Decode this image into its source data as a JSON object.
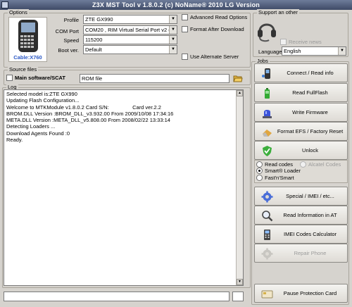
{
  "window": {
    "title": "Z3X MST Tool v 1.8.0.2 (c) NoName® 2010 LG Version"
  },
  "options": {
    "group_label": "Options",
    "phone_label": "Cable:X760",
    "profile": {
      "label": "Profile",
      "value": "ZTE GX990"
    },
    "com_port": {
      "label": "COM Port",
      "value": "COM20 , RIM Virtual Serial Port v2 (CO"
    },
    "speed": {
      "label": "Speed",
      "value": "115200"
    },
    "boot_ver": {
      "label": "Boot ver.",
      "value": "Default"
    },
    "advanced_read": {
      "label": "Advanced Read Options",
      "checked": false
    },
    "format_after": {
      "label": "Format After Download",
      "checked": false
    },
    "alt_server": {
      "label": "Use Alternate Server",
      "checked": false
    }
  },
  "support": {
    "group_label": "Support an other",
    "receive_news": {
      "label": "Receive news",
      "checked": false
    },
    "language": {
      "label": "Language",
      "value": "English"
    }
  },
  "source": {
    "group_label": "Source files",
    "main_label": "Main software/SCAT",
    "rom_value": "ROM file"
  },
  "log": {
    "group_label": "Log",
    "lines": [
      "Selected model is:ZTE GX990",
      "Updating Flash Configuration...",
      "Welcome to MTKModule v1.8.0.2 Card S/N:                Card ver.2.2",
      "BROM.DLL Version :BROM_DLL_v3.932.00 From 2009/10/08 17:34:16",
      "META.DLL Version :META_DLL_v5.808.00 From 2008/02/22 13:33:14",
      "Detecting Loaders ...",
      "Download Agents Found :0",
      "Ready."
    ]
  },
  "jobs": {
    "group_label": "Jobs",
    "connect": "Connect / Read info",
    "read_flash": "Read FullFlash",
    "write_fw": "Write Firmware",
    "format": "Format EFS / Factory Reset",
    "unlock": "Unlock",
    "read_codes": "Read codes",
    "smart_loader": "Smart® Loader",
    "fast_smart": "Fast'n'Smart",
    "alcatel_codes": "Alcatel Codes",
    "special": "Special / IMEI / etc...",
    "read_at": "Read Information in AT",
    "imei_calc": "IMEI Codes Calculator",
    "repair": "Repair Phone",
    "pause": "Pause Protection Card"
  }
}
